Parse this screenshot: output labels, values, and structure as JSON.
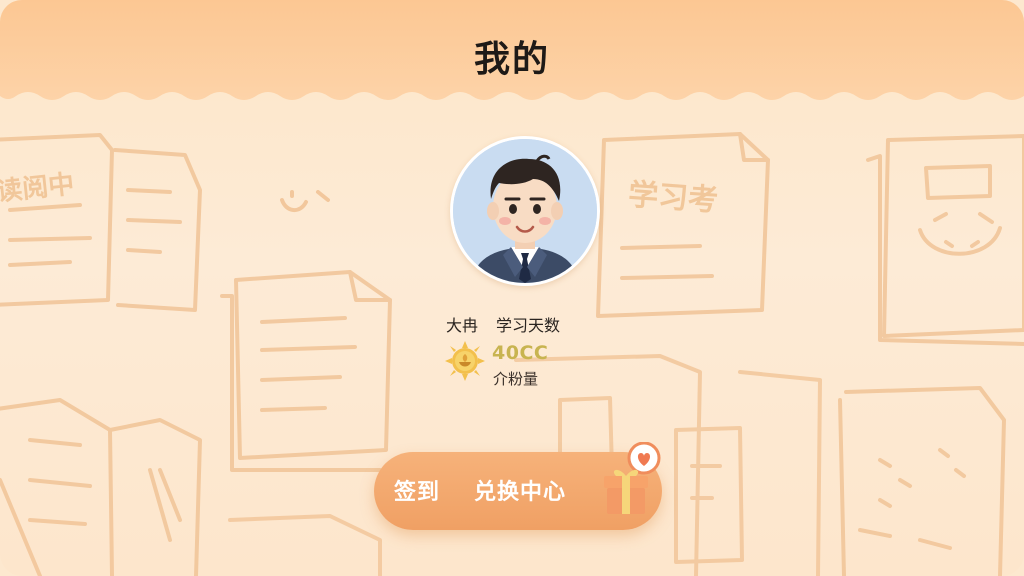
{
  "header": {
    "title": "我的"
  },
  "profile": {
    "avatar_icon": "businessman-avatar-icon",
    "username": "大冉",
    "study_days_label": "学习天数",
    "badge": {
      "icon": "sun-medal-icon",
      "value": "40CC",
      "label": "介粉量"
    }
  },
  "actions": {
    "checkin_label": "签到",
    "exchange_label": "兑换中心",
    "gift_icon": "gift-heart-icon"
  },
  "background": {
    "decor_texts": [
      "读阅中",
      "学习考"
    ]
  },
  "colors": {
    "header_bg": "#fbd09f",
    "page_bg": "#fde8cf",
    "pill_bg": "#f2a66a",
    "badge_value": "#c8b450",
    "title_text": "#1e1a17",
    "sketch_stroke": "#f1c497"
  }
}
